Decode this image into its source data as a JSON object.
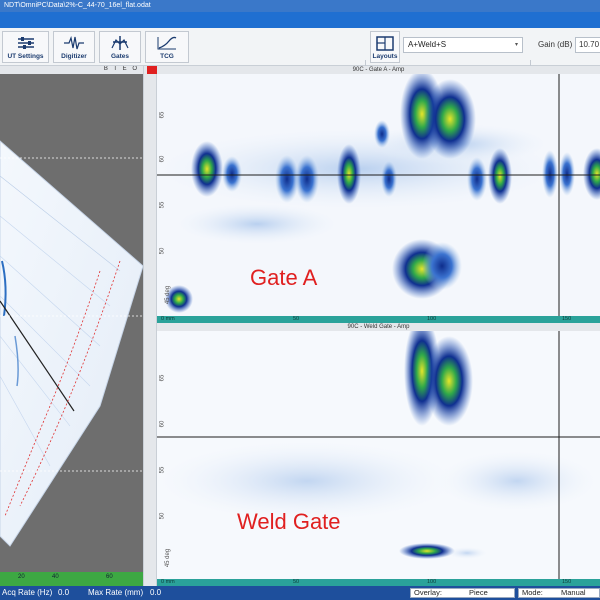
{
  "window": {
    "title": "NDT\\OmniPC\\Data\\2%-C_44-70_16el_flat.odat"
  },
  "toolbar": {
    "buttons": [
      {
        "label": "UT Settings",
        "icon": "sliders-icon"
      },
      {
        "label": "Digitizer",
        "icon": "waveform-icon"
      },
      {
        "label": "Gates",
        "icon": "gates-icon"
      },
      {
        "label": "TCG",
        "icon": "curve-icon"
      },
      {
        "label": "Layouts",
        "icon": "layout-grid-icon"
      }
    ],
    "layout_select": "A+Weld+S",
    "gain_label": "Gain (dB)",
    "gain_value": "10.70"
  },
  "left_panel": {
    "header_buttons": "B T E O",
    "footer_ticks": [
      "20",
      "40",
      "60"
    ]
  },
  "panels": [
    {
      "title": "90C - Gate A - Amp",
      "overlay_label": "Gate A",
      "x_ticks": [
        "0 mm",
        "50",
        "100",
        "150"
      ],
      "y_ticks": [
        "65",
        "60",
        "55",
        "50",
        "45 deg"
      ]
    },
    {
      "title": "90C - Weld Gate - Amp",
      "overlay_label": "Weld Gate",
      "x_ticks": [
        "0 mm",
        "50",
        "100",
        "150"
      ],
      "y_ticks": [
        "65",
        "60",
        "55",
        "50",
        "45 deg"
      ]
    }
  ],
  "statusbar": {
    "acq_rate_label": "Acq Rate (Hz)",
    "acq_rate_value": "0.0",
    "max_rate_label": "Max Rate (mm)",
    "max_rate_value": "0.0",
    "overlay_label": "Overlay:",
    "overlay_value": "Piece",
    "mode_label": "Mode:",
    "mode_value": "Manual"
  },
  "colors": {
    "accent_blue": "#1f6fd1",
    "scale_teal": "#2aa29a",
    "overlay_red": "#e02020",
    "status_blue": "#1e4f9c"
  }
}
